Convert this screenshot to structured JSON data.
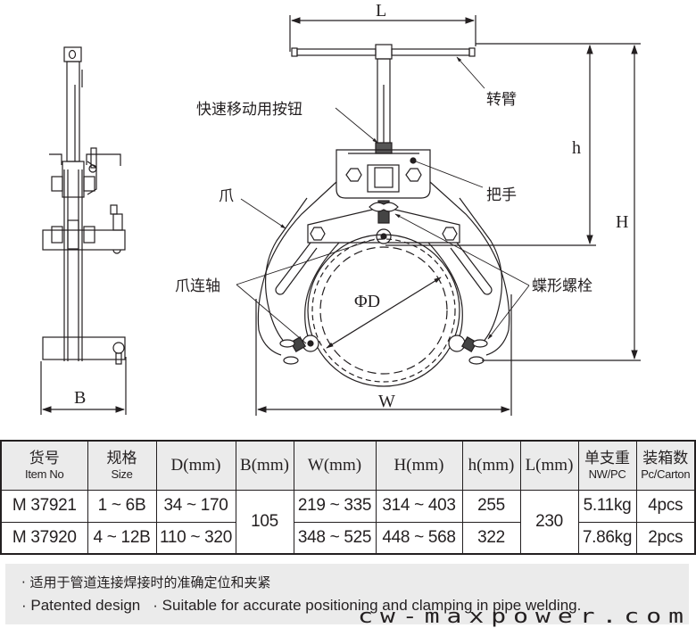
{
  "drawing": {
    "labels": {
      "quick_button": "快速移动用按钮",
      "rotating_arm": "转臂",
      "handle": "把手",
      "claw": "爪",
      "claw_shaft": "爪连轴",
      "wing_bolt": "蝶形螺栓"
    },
    "dimensions": {
      "L": "L",
      "h": "h",
      "H": "H",
      "B": "B",
      "W": "W",
      "D": "ΦD"
    }
  },
  "table": {
    "headers": [
      {
        "cn": "货号",
        "en": "Item No"
      },
      {
        "cn": "规格",
        "en": "Size"
      },
      {
        "dim": "D(mm)"
      },
      {
        "dim": "B(mm)"
      },
      {
        "dim": "W(mm)"
      },
      {
        "dim": "H(mm)"
      },
      {
        "dim": "h(mm)"
      },
      {
        "dim": "L(mm)"
      },
      {
        "cn": "单支重",
        "en": "NW/PC"
      },
      {
        "cn": "装箱数",
        "en": "Pc/Carton"
      }
    ],
    "rows": [
      {
        "item": "M 37921",
        "size": "1 ~ 6B",
        "d": "34 ~ 170",
        "w": "219 ~ 335",
        "H": "314 ~ 403",
        "h": "255",
        "nw": "5.11kg",
        "pcs": "4pcs"
      },
      {
        "item": "M 37920",
        "size": "4 ~ 12B",
        "d": "110 ~ 320",
        "w": "348 ~ 525",
        "H": "448 ~ 568",
        "h": "322",
        "nw": "7.86kg",
        "pcs": "2pcs"
      }
    ],
    "shared": {
      "b": "105",
      "l": "230"
    }
  },
  "notes": {
    "cn": "· 适用于管道连接焊接时的准确定位和夹紧",
    "en_1": "· Patented design",
    "en_2": "· Suitable for accurate positioning and clamping in pipe welding."
  },
  "watermark": "cw-maxpower.com"
}
